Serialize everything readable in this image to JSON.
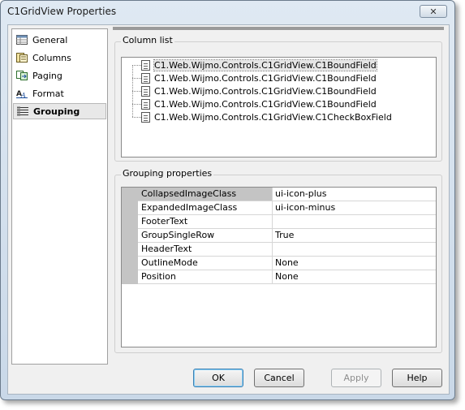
{
  "window": {
    "title": "C1GridView Properties",
    "close_label": "✕"
  },
  "nav": {
    "items": [
      {
        "label": "General",
        "icon": "general-icon"
      },
      {
        "label": "Columns",
        "icon": "columns-icon"
      },
      {
        "label": "Paging",
        "icon": "paging-icon"
      },
      {
        "label": "Format",
        "icon": "format-icon"
      },
      {
        "label": "Grouping",
        "icon": "grouping-icon",
        "selected": true
      }
    ]
  },
  "column_list": {
    "title": "Column list",
    "items": [
      "C1.Web.Wijmo.Controls.C1GridView.C1BoundField",
      "C1.Web.Wijmo.Controls.C1GridView.C1BoundField",
      "C1.Web.Wijmo.Controls.C1GridView.C1BoundField",
      "C1.Web.Wijmo.Controls.C1GridView.C1BoundField",
      "C1.Web.Wijmo.Controls.C1GridView.C1CheckBoxField"
    ]
  },
  "grouping": {
    "title": "Grouping properties",
    "rows": [
      {
        "name": "CollapsedImageClass",
        "value": "ui-icon-plus"
      },
      {
        "name": "ExpandedImageClass",
        "value": "ui-icon-minus"
      },
      {
        "name": "FooterText",
        "value": ""
      },
      {
        "name": "GroupSingleRow",
        "value": "True"
      },
      {
        "name": "HeaderText",
        "value": ""
      },
      {
        "name": "OutlineMode",
        "value": "None"
      },
      {
        "name": "Position",
        "value": "None"
      }
    ]
  },
  "buttons": {
    "ok": "OK",
    "cancel": "Cancel",
    "apply": "Apply",
    "help": "Help"
  }
}
